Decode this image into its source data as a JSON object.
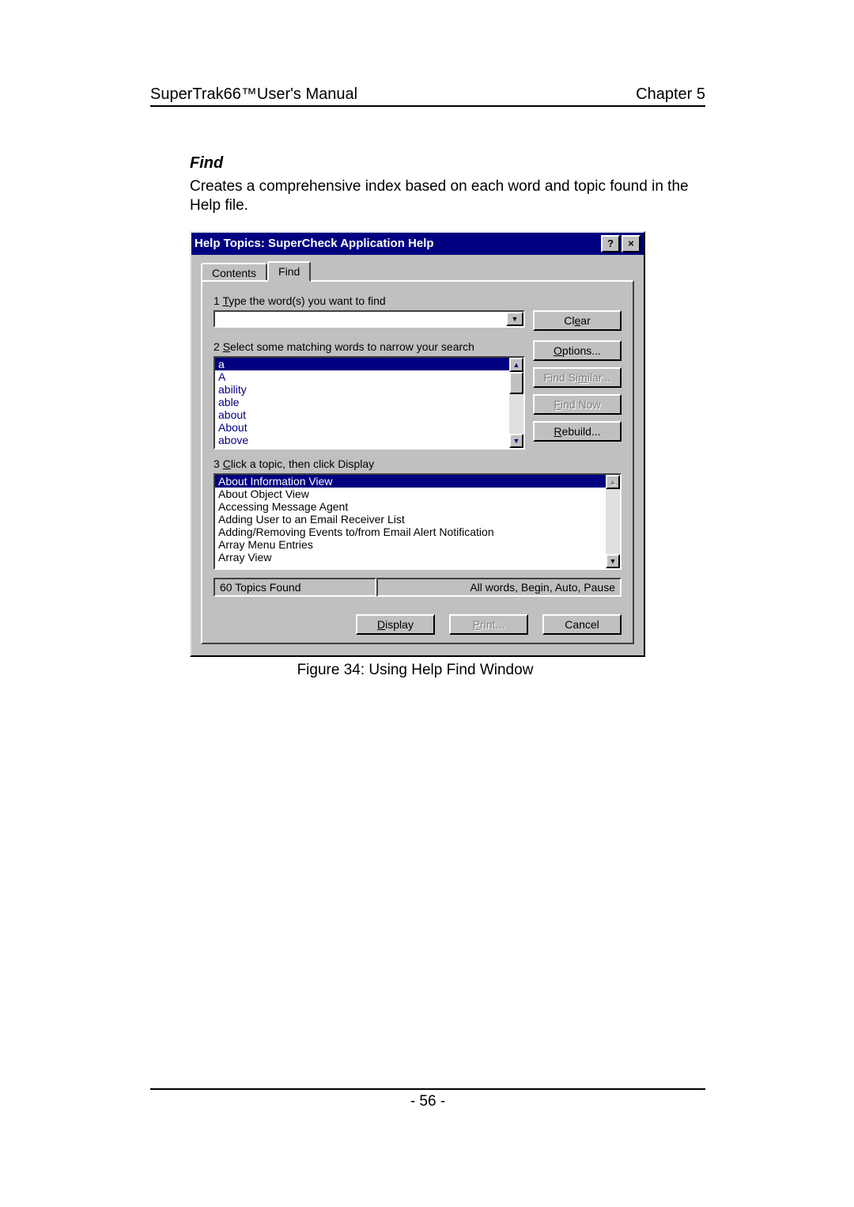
{
  "doc": {
    "header_left": "SuperTrak66™User's Manual",
    "header_right": "Chapter 5",
    "section_title": "Find",
    "section_body": "Creates a comprehensive index based on each word and topic found in the Help file.",
    "figure_caption": "Figure 34: Using Help Find Window",
    "page_number": "- 56 -"
  },
  "dialog": {
    "title": "Help Topics: SuperCheck Application Help",
    "help_btn": "?",
    "close_btn": "×",
    "tabs": {
      "contents": "Contents",
      "find": "Find"
    },
    "step1_label": "1 Type the word(s) you want to find",
    "search_value": "",
    "step2_label": "2 Select some matching words to narrow your search",
    "step3_label": "3 Click a topic, then click Display",
    "right_buttons": {
      "clear": "Clear",
      "options": "Options...",
      "find_similar": "Find Similar...",
      "find_now": "Find Now",
      "rebuild": "Rebuild..."
    },
    "words_list": [
      "a",
      "A",
      "ability",
      "able",
      "about",
      "About",
      "above"
    ],
    "topics_list": [
      "About Information View",
      "About Object View",
      "Accessing Message Agent",
      "Adding User to an Email Receiver List",
      "Adding/Removing Events to/from Email Alert Notification",
      "Array Menu Entries",
      "Array View"
    ],
    "status_left": "60 Topics Found",
    "status_right": "All words, Begin, Auto, Pause",
    "bottom_buttons": {
      "display": "Display",
      "print": "Print...",
      "cancel": "Cancel"
    }
  }
}
